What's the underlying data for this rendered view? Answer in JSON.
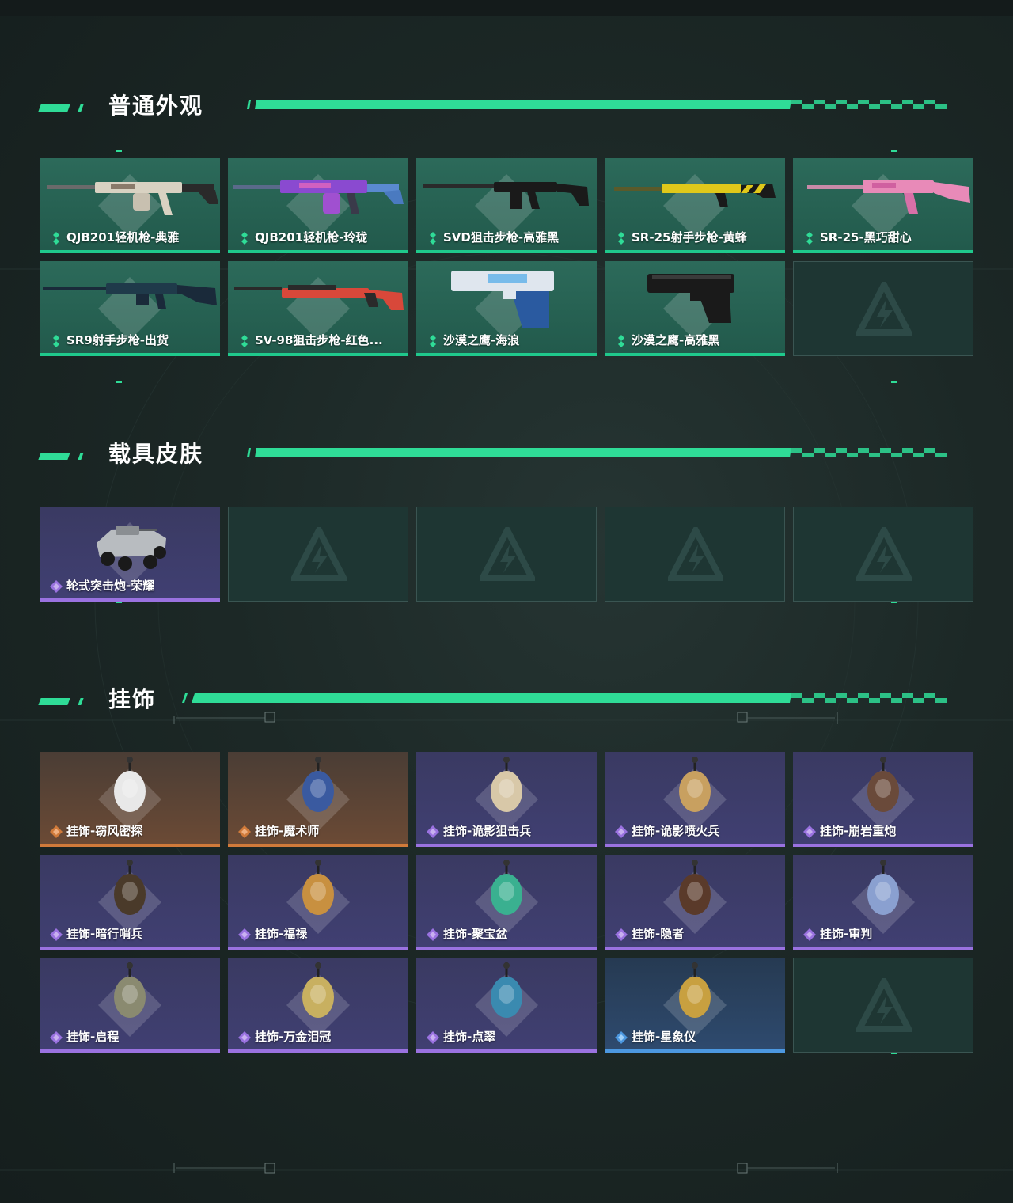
{
  "sections": {
    "weapons": {
      "title": "普通外观",
      "items": [
        {
          "label": "QJB201轻机枪-典雅",
          "rarity": "green",
          "icon": "rifle-icon",
          "color": "#d9d2c2"
        },
        {
          "label": "QJB201轻机枪-玲珑",
          "rarity": "green",
          "icon": "rifle-icon",
          "color": "#8a4ad0"
        },
        {
          "label": "SVD狙击步枪-高雅黑",
          "rarity": "green",
          "icon": "rifle-icon",
          "color": "#1a1a1a"
        },
        {
          "label": "SR-25射手步枪-黄蜂",
          "rarity": "green",
          "icon": "rifle-icon",
          "color": "#e0c81a"
        },
        {
          "label": "SR-25-黑巧甜心",
          "rarity": "green",
          "icon": "rifle-icon",
          "color": "#e88ab8"
        },
        {
          "label": "SR9射手步枪-出货",
          "rarity": "green",
          "icon": "rifle-icon",
          "color": "#1f3a4a"
        },
        {
          "label": "SV-98狙击步枪-红色...",
          "rarity": "green",
          "icon": "rifle-icon",
          "color": "#d8483a"
        },
        {
          "label": "沙漠之鹰-海浪",
          "rarity": "green",
          "icon": "pistol-icon",
          "color": "#2a5aa0"
        },
        {
          "label": "沙漠之鹰-高雅黑",
          "rarity": "green",
          "icon": "pistol-icon",
          "color": "#1a1a1a"
        },
        {
          "label": "",
          "rarity": "empty",
          "icon": "empty-slot-icon",
          "color": ""
        }
      ]
    },
    "vehicles": {
      "title": "载具皮肤",
      "items": [
        {
          "label": "轮式突击炮-荣耀",
          "rarity": "purple",
          "icon": "vehicle-icon",
          "color": "#b8bcc0"
        },
        {
          "label": "",
          "rarity": "empty",
          "icon": "empty-slot-icon",
          "color": ""
        },
        {
          "label": "",
          "rarity": "empty",
          "icon": "empty-slot-icon",
          "color": ""
        },
        {
          "label": "",
          "rarity": "empty",
          "icon": "empty-slot-icon",
          "color": ""
        },
        {
          "label": "",
          "rarity": "empty",
          "icon": "empty-slot-icon",
          "color": ""
        }
      ]
    },
    "charms": {
      "title": "挂饰",
      "items": [
        {
          "label": "挂饰-窃风密探",
          "rarity": "orange",
          "icon": "charm-icon",
          "color": "#e8e8e8"
        },
        {
          "label": "挂饰-魔术师",
          "rarity": "orange",
          "icon": "charm-icon",
          "color": "#3a5aa0"
        },
        {
          "label": "挂饰-诡影狙击兵",
          "rarity": "purple",
          "icon": "charm-icon",
          "color": "#d8c8a8"
        },
        {
          "label": "挂饰-诡影喷火兵",
          "rarity": "purple",
          "icon": "charm-icon",
          "color": "#c8a060"
        },
        {
          "label": "挂饰-崩岩重炮",
          "rarity": "purple",
          "icon": "charm-icon",
          "color": "#6a4a3a"
        },
        {
          "label": "挂饰-暗行哨兵",
          "rarity": "purple",
          "icon": "charm-icon",
          "color": "#4a3a2a"
        },
        {
          "label": "挂饰-福禄",
          "rarity": "purple",
          "icon": "charm-icon",
          "color": "#c89040"
        },
        {
          "label": "挂饰-聚宝盆",
          "rarity": "purple",
          "icon": "charm-icon",
          "color": "#3ab090"
        },
        {
          "label": "挂饰-隐者",
          "rarity": "purple",
          "icon": "charm-icon",
          "color": "#5a3a2a"
        },
        {
          "label": "挂饰-审判",
          "rarity": "purple",
          "icon": "charm-icon",
          "color": "#8aa0d0"
        },
        {
          "label": "挂饰-启程",
          "rarity": "purple",
          "icon": "charm-icon",
          "color": "#8a8a70"
        },
        {
          "label": "挂饰-万金泪冠",
          "rarity": "purple",
          "icon": "charm-icon",
          "color": "#c8b060"
        },
        {
          "label": "挂饰-点翠",
          "rarity": "purple",
          "icon": "charm-icon",
          "color": "#3a8ab0"
        },
        {
          "label": "挂饰-星象仪",
          "rarity": "blue",
          "icon": "charm-icon",
          "color": "#c8a040"
        },
        {
          "label": "",
          "rarity": "empty",
          "icon": "empty-slot-icon",
          "color": ""
        }
      ]
    }
  },
  "colors": {
    "accent": "#2fdc97",
    "green": "#1fc98c",
    "purple": "#9a72e0",
    "orange": "#d07a3a",
    "blue": "#4c98e0"
  }
}
